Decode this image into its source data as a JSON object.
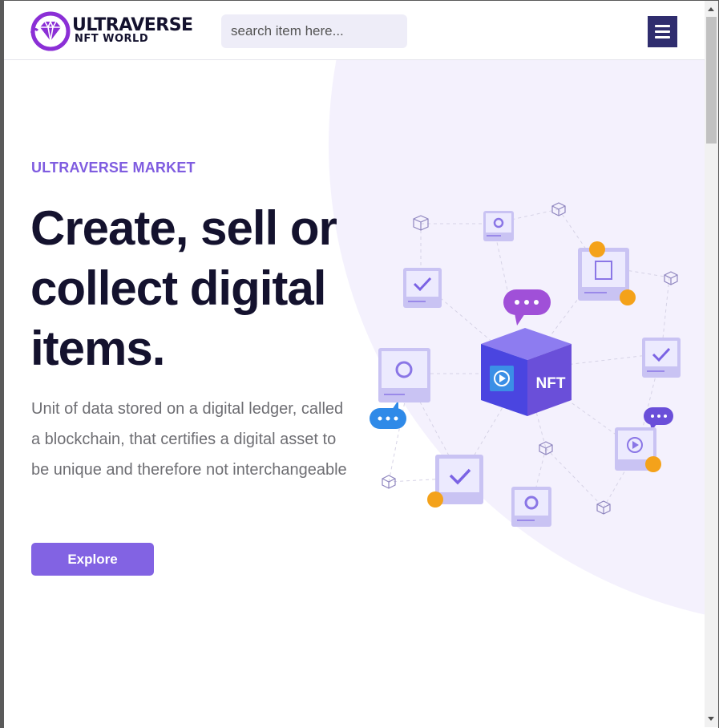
{
  "header": {
    "logo_line1": "ULTRAVERSE",
    "logo_line2": "NFT WORLD",
    "search_placeholder": "search item here...",
    "menu_icon": "hamburger-menu-icon"
  },
  "hero": {
    "eyebrow": "ULTRAVERSE MARKET",
    "title": "Create, sell or collect digital items.",
    "description": "Unit of data stored on a digital ledger, called a blockchain, that certifies a digital asset to be unique and therefore not interchangeable",
    "explore_label": "Explore"
  },
  "illustration": {
    "cube_label": "NFT"
  },
  "colors": {
    "accent": "#8263e3",
    "brand_dark": "#2f2d6e",
    "title": "#14122e",
    "background_blob": "#f4f1fd"
  }
}
